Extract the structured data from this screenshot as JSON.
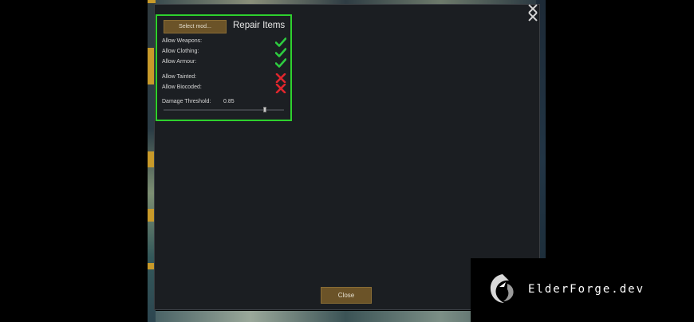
{
  "dialog": {
    "select_mod_label": "Select mod...",
    "title": "Repair Items",
    "options": [
      {
        "label": "Allow Weapons:",
        "enabled": true
      },
      {
        "label": "Allow Clothing:",
        "enabled": true
      },
      {
        "label": "Allow Armour:",
        "enabled": true
      },
      {
        "label": "Allow Tainted:",
        "enabled": false
      },
      {
        "label": "Allow Biocoded:",
        "enabled": false
      }
    ],
    "threshold_label": "Damage Threshold:",
    "threshold_value": "0.85",
    "close_label": "Close"
  },
  "watermark": {
    "text": "ElderForge.dev"
  },
  "colors": {
    "panel_border": "#2ed12e",
    "check": "#2ecc40",
    "cross": "#e0262d",
    "button": "#6b5328"
  }
}
